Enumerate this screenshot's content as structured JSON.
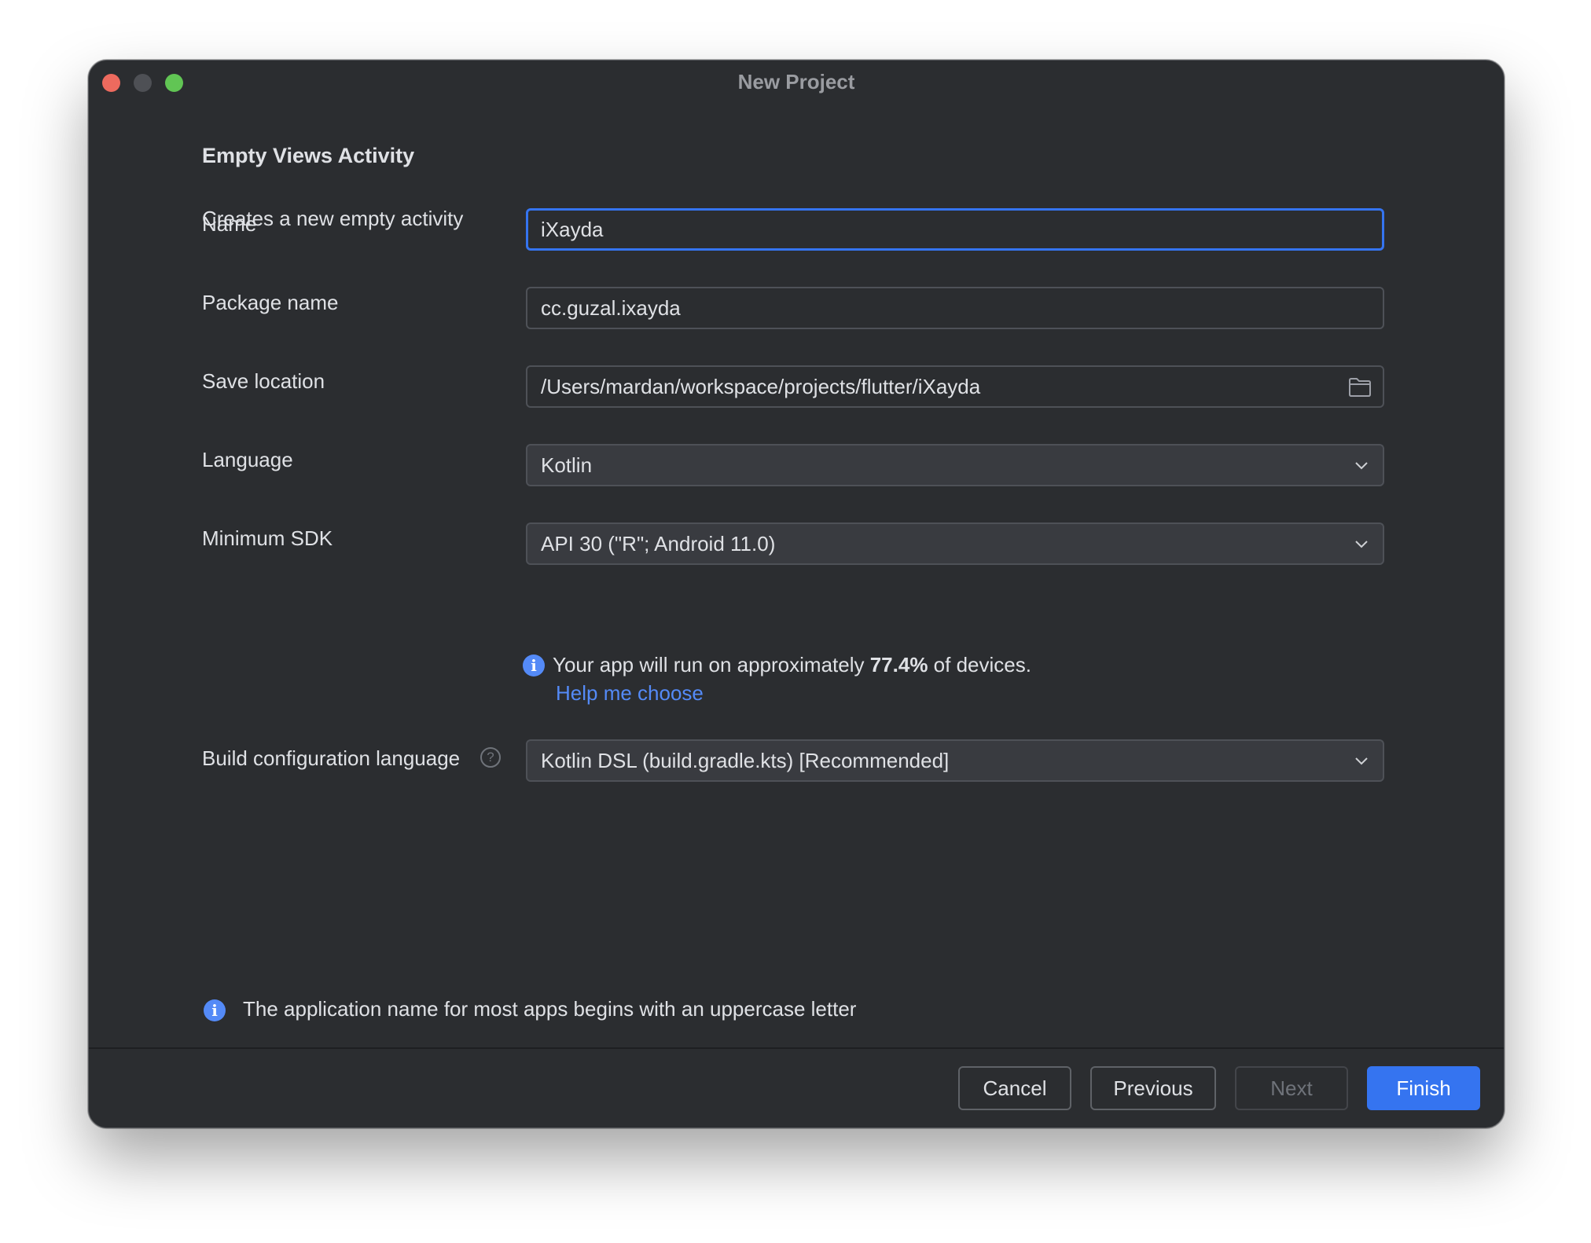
{
  "window": {
    "title": "New Project"
  },
  "header": {
    "heading": "Empty Views Activity",
    "description": "Creates a new empty activity"
  },
  "form": {
    "name": {
      "label": "Name",
      "value": "iXayda"
    },
    "package_name": {
      "label": "Package name",
      "value": "cc.guzal.ixayda"
    },
    "save_location": {
      "label": "Save location",
      "value": "/Users/mardan/workspace/projects/flutter/iXayda",
      "icon": "folder-icon"
    },
    "language": {
      "label": "Language",
      "value": "Kotlin"
    },
    "minimum_sdk": {
      "label": "Minimum SDK",
      "value": "API 30 (\"R\"; Android 11.0)"
    },
    "sdk_info": {
      "prefix": "Your app will run on approximately ",
      "percent": "77.4%",
      "suffix": " of devices.",
      "link": "Help me choose"
    },
    "build_config_language": {
      "label": "Build configuration language",
      "value": "Kotlin DSL (build.gradle.kts) [Recommended]",
      "help_icon": "?"
    }
  },
  "hint": {
    "text": "The application name for most apps begins with an uppercase letter"
  },
  "footer": {
    "cancel": "Cancel",
    "previous": "Previous",
    "next": "Next",
    "finish": "Finish"
  },
  "colors": {
    "background": "#2b2d30",
    "accent": "#3574f0",
    "link": "#548af7",
    "text": "#dfe1e5"
  }
}
